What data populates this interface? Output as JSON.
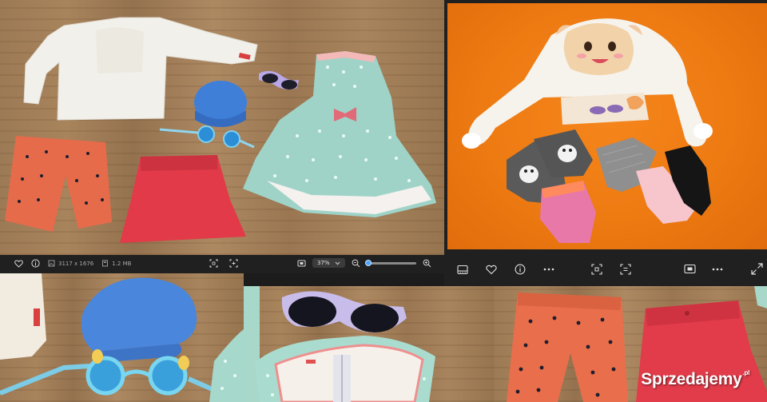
{
  "top_left_viewer": {
    "file_info": {
      "resolution": "3117 x 1676",
      "file_size": "1.2 MB"
    },
    "zoom": {
      "value_label": "37%",
      "level": 0.37
    },
    "icons": [
      "heart-icon",
      "info-icon",
      "image-dimensions-icon",
      "file-size-icon",
      "crop-icon",
      "enhance-icon",
      "fit-screen-icon",
      "zoom-out-icon",
      "zoom-in-icon",
      "chevron-down-icon"
    ]
  },
  "top_right_viewer": {
    "icons": [
      "filmstrip-icon",
      "heart-icon",
      "info-icon",
      "more-icon",
      "crop-icon",
      "enhance-icon",
      "more-icon",
      "fit-screen-icon",
      "more-icon",
      "fullscreen-icon"
    ]
  },
  "watermark": {
    "brand": "Sprzedajemy",
    "tld": ".pl"
  },
  "colors": {
    "wood": "#a07d56",
    "orange_backdrop": "#ee7a12",
    "toolbar_bg": "#202020",
    "accent": "#4aa3ff"
  }
}
